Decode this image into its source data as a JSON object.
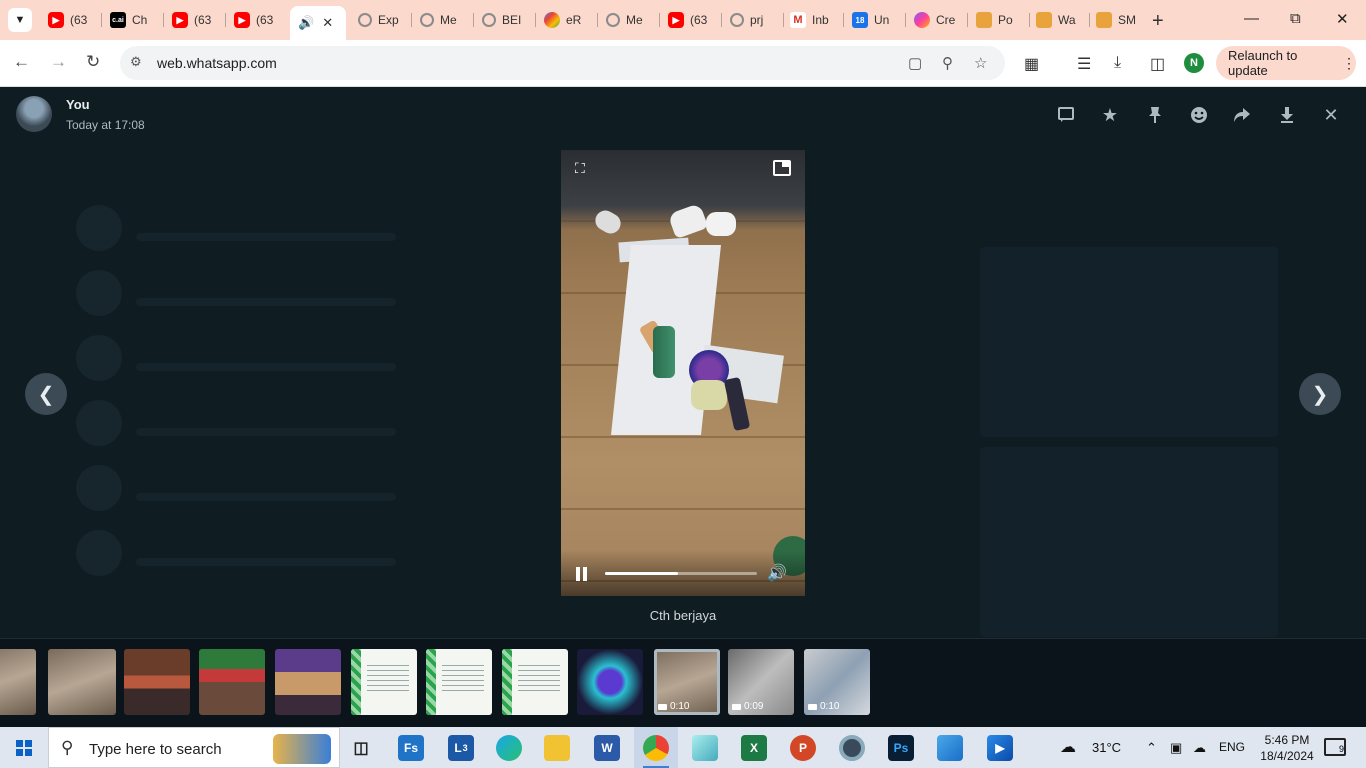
{
  "browser": {
    "tabs": [
      {
        "title": "(63",
        "icon": "youtube-icon"
      },
      {
        "title": "Ch",
        "icon": "character-ai-icon"
      },
      {
        "title": "(63",
        "icon": "youtube-icon"
      },
      {
        "title": "(63",
        "icon": "youtube-icon"
      },
      {
        "title": "",
        "icon": "speaker-icon",
        "active": true
      },
      {
        "title": "Exp",
        "icon": "globe-icon"
      },
      {
        "title": "Me",
        "icon": "globe-icon"
      },
      {
        "title": "BEI",
        "icon": "globe-icon"
      },
      {
        "title": "eR",
        "icon": "chrome-icon"
      },
      {
        "title": "Me",
        "icon": "globe-icon"
      },
      {
        "title": "(63",
        "icon": "youtube-icon"
      },
      {
        "title": "prj",
        "icon": "globe-icon"
      },
      {
        "title": "Inb",
        "icon": "gmail-icon"
      },
      {
        "title": "Un",
        "icon": "calendar-icon"
      },
      {
        "title": "Cre",
        "icon": "canva-icon"
      },
      {
        "title": "Po",
        "icon": "book-icon"
      },
      {
        "title": "Wa",
        "icon": "book-icon"
      },
      {
        "title": "SM",
        "icon": "book-icon"
      }
    ],
    "url": "web.whatsapp.com",
    "profile_initial": "N",
    "relaunch_label": "Relaunch to update"
  },
  "viewer": {
    "sender_name": "You",
    "sender_time": "Today at 17:08",
    "caption": "Cth berjaya",
    "video_progress_fraction": 0.48,
    "header_icons": [
      "reply-icon",
      "star-icon",
      "pin-icon",
      "emoji-icon",
      "forward-icon",
      "download-icon",
      "close-icon"
    ]
  },
  "thumbnails": [
    {
      "kind": "floor",
      "duration": ""
    },
    {
      "kind": "floor",
      "duration": ""
    },
    {
      "kind": "people",
      "duration": ""
    },
    {
      "kind": "people2",
      "duration": ""
    },
    {
      "kind": "people3",
      "duration": ""
    },
    {
      "kind": "doc",
      "duration": ""
    },
    {
      "kind": "doc",
      "duration": ""
    },
    {
      "kind": "doc",
      "duration": ""
    },
    {
      "kind": "robot",
      "duration": ""
    },
    {
      "kind": "floor",
      "duration": "0:10",
      "selected": true
    },
    {
      "kind": "grey",
      "duration": "0:09"
    },
    {
      "kind": "blue",
      "duration": "0:10"
    }
  ],
  "taskbar": {
    "search_placeholder": "Type here to search",
    "weather": "31°C",
    "language": "ENG",
    "time": "5:46 PM",
    "date": "18/4/2024",
    "notifications": "9",
    "lync_badge": "3",
    "apps": [
      "task-view-icon",
      "fs-icon",
      "lync-icon",
      "edge-icon",
      "file-explorer-icon",
      "word-icon",
      "chrome-icon",
      "crystal-icon",
      "excel-icon",
      "powerpoint-icon",
      "circle-app-icon",
      "photoshop-icon",
      "photos-icon",
      "video-editor-icon"
    ]
  },
  "colors": {
    "tab_strip": "#fbd9cc",
    "viewer_bg": "#0b141a",
    "accent": "#00a884"
  }
}
